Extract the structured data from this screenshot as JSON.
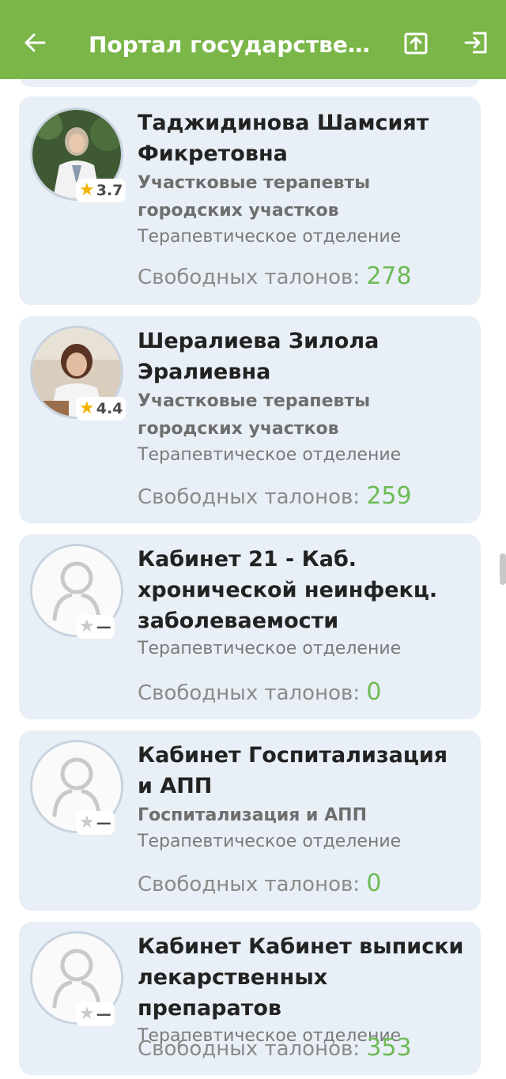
{
  "header": {
    "title": "Портал государственн...",
    "back_icon": "arrow-left-icon",
    "share_icon": "share-upload-icon",
    "logout_icon": "logout-icon",
    "background": "#7ab648"
  },
  "tickets_label": "Свободных талонов: ",
  "doctors": [
    {
      "name": "Таджидинова Шамсият Фикретовна",
      "specialty": "Участковые терапевты городских участков",
      "department": "Терапевтическое отделение",
      "rating": "3.7",
      "tickets": "278",
      "has_photo": true
    },
    {
      "name": "Шералиева Зилола Эралиевна",
      "specialty": "Участковые терапевты городских участков",
      "department": "Терапевтическое отделение",
      "rating": "4.4",
      "tickets": "259",
      "has_photo": true
    },
    {
      "name": "Кабинет 21 - Каб. хронической неинфекц. заболеваемости",
      "specialty": "",
      "department": "Терапевтическое отделение",
      "rating": "—",
      "tickets": "0",
      "has_photo": false
    },
    {
      "name": "Кабинет Госпитализация и АПП",
      "specialty": "Госпитализация и АПП",
      "department": "Терапевтическое отделение",
      "rating": "—",
      "tickets": "0",
      "has_photo": false
    },
    {
      "name": "Кабинет Кабинет выписки лекарственных препаратов",
      "specialty": "",
      "department": "Терапевтическое отделение",
      "rating": "—",
      "tickets": "353",
      "has_photo": false
    }
  ],
  "colors": {
    "card_bg": "#e9eff6",
    "ticket_count": "#6dbb56",
    "star": "#f4b400"
  }
}
